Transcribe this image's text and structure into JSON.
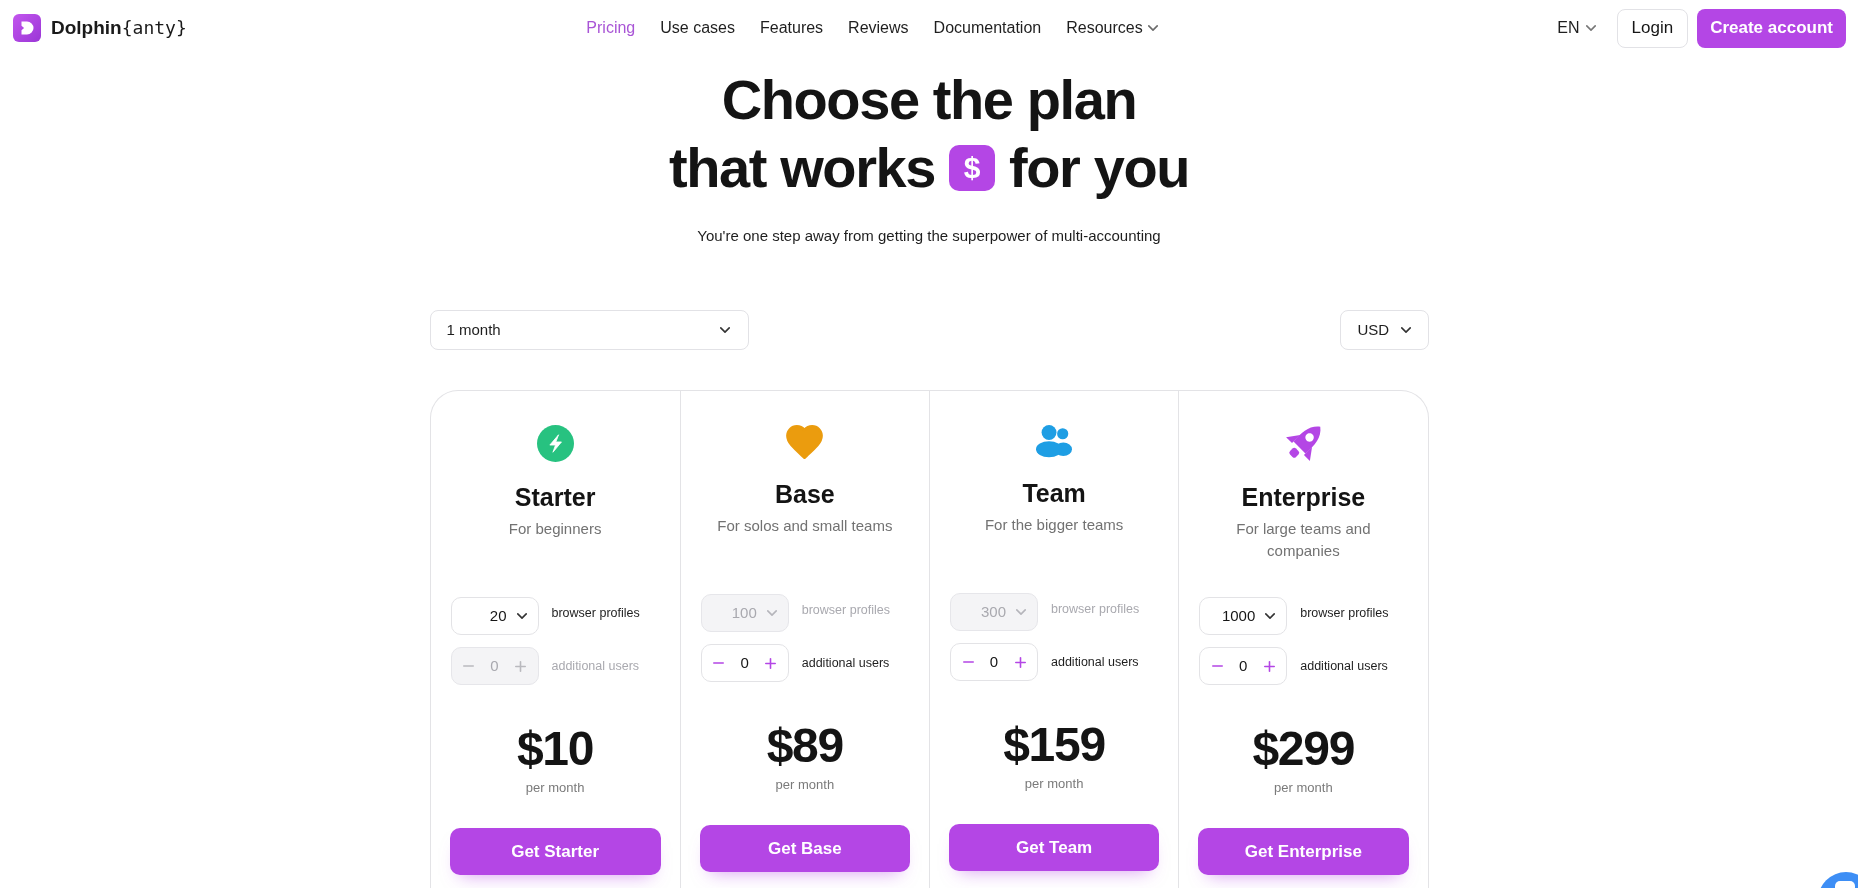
{
  "header": {
    "logo_text": "**Dolphin**{anty}",
    "nav": [
      {
        "label": "Pricing",
        "kind": "link",
        "selected": true
      },
      {
        "label": "Use cases",
        "kind": "link",
        "selected": false
      },
      {
        "label": "Features",
        "kind": "link",
        "selected": false
      },
      {
        "label": "Reviews",
        "kind": "link",
        "selected": false
      },
      {
        "label": "Documentation",
        "kind": "link",
        "selected": false
      },
      {
        "label": "Resources",
        "kind": "menu",
        "selected": false
      }
    ],
    "language": "EN",
    "login": "Login",
    "create_account": "Create account"
  },
  "hero": {
    "title_line_1": "Choose the plan",
    "title_line_2_before": "that works",
    "title_badge": "$",
    "title_line_2_after": "for you",
    "subtitle": "You're one step away from getting the superpower of multi-accounting"
  },
  "filters": {
    "period": "1 month",
    "currency": "USD"
  },
  "plans": [
    {
      "name": "Starter",
      "color": "#27c280",
      "description": "For beginners",
      "profiles": {
        "value": "20",
        "disabled": false
      },
      "profiles_label": "browser profiles",
      "users": {
        "value": "0",
        "disabled": true
      },
      "users_label": "additional users",
      "price": "$10",
      "price_period": "per month",
      "button": "Get Starter"
    },
    {
      "name": "Base",
      "color": "#eb9c0e",
      "description": "For solos and small teams",
      "profiles": {
        "value": "100",
        "disabled": true
      },
      "profiles_label": "browser profiles",
      "users": {
        "value": "0",
        "disabled": false
      },
      "users_label": "additional users",
      "price": "$89",
      "price_period": "per month",
      "button": "Get Base"
    },
    {
      "name": "Team",
      "color": "#1e9ee4",
      "description": "For the bigger teams",
      "profiles": {
        "value": "300",
        "disabled": true
      },
      "profiles_label": "browser profiles",
      "users": {
        "value": "0",
        "disabled": false
      },
      "users_label": "additional users",
      "price": "$159",
      "price_period": "per month",
      "button": "Get Team"
    },
    {
      "name": "Enterprise",
      "color": "#b446e5",
      "description": "For large teams and companies",
      "profiles": {
        "value": "1000",
        "disabled": false
      },
      "profiles_label": "browser profiles",
      "users": {
        "value": "0",
        "disabled": false
      },
      "users_label": "additional users",
      "price": "$299",
      "price_period": "per month",
      "button": "Get Enterprise"
    }
  ]
}
